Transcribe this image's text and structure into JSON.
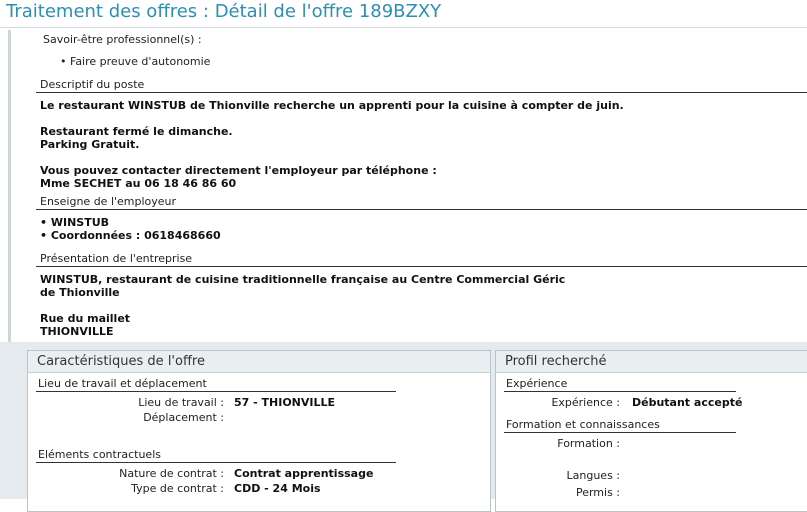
{
  "header": {
    "title": "Traitement des offres : Détail de l'offre 189BZXY"
  },
  "savoir_etre": {
    "label": "Savoir-être professionnel(s) :",
    "items": [
      "Faire preuve d'autonomie"
    ]
  },
  "descriptif": {
    "heading": "Descriptif du poste",
    "lines": [
      "Le restaurant WINSTUB de Thionville recherche un apprenti pour la cuisine à compter de juin.",
      "Restaurant fermé le dimanche.",
      "Parking Gratuit.",
      "Vous pouvez contacter directement l'employeur par téléphone :",
      "Mme SECHET au 06 18 46 86 60"
    ]
  },
  "enseigne": {
    "heading": "Enseigne de l'employeur",
    "items": [
      "• WINSTUB",
      "• Coordonnées : 0618468660"
    ]
  },
  "presentation": {
    "heading": "Présentation de l'entreprise",
    "lines": [
      "WINSTUB, restaurant de cuisine traditionnelle française au Centre Commercial Géric",
      "de Thionville",
      "Rue du maillet",
      "THIONVILLE"
    ]
  },
  "caracteristiques": {
    "title": "Caractéristiques de l'offre",
    "lieu": {
      "heading": "Lieu de travail et déplacement",
      "rows": [
        {
          "key": "Lieu de travail :",
          "value": "57 - THIONVILLE"
        },
        {
          "key": "Déplacement :",
          "value": ""
        }
      ]
    },
    "elements": {
      "heading": "Eléments contractuels",
      "rows": [
        {
          "key": "Nature de contrat :",
          "value": "Contrat apprentissage"
        },
        {
          "key": "Type de contrat :",
          "value": "CDD - 24 Mois"
        }
      ]
    }
  },
  "profil": {
    "title": "Profil recherché",
    "experience": {
      "heading": "Expérience",
      "rows": [
        {
          "key": "Expérience :",
          "value": "Débutant accepté"
        }
      ]
    },
    "formation": {
      "heading": "Formation et connaissances",
      "rows": [
        {
          "key": "Formation :",
          "value": ""
        },
        {
          "key": "Langues :",
          "value": ""
        },
        {
          "key": "Permis :",
          "value": ""
        }
      ]
    }
  }
}
